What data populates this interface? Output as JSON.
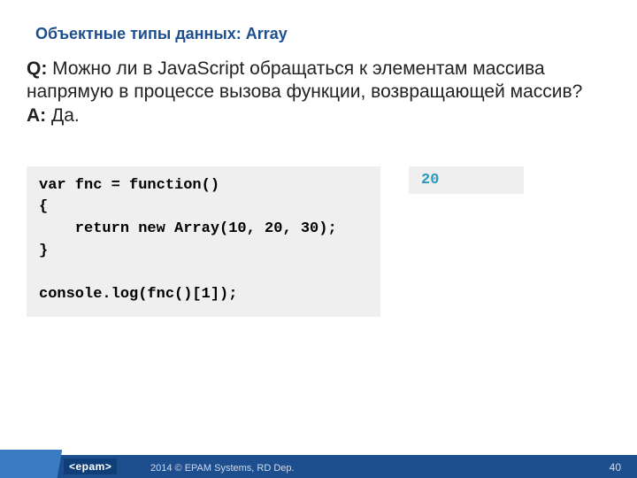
{
  "header": {
    "title": "Объектные типы данных: Array"
  },
  "qa": {
    "q_label": "Q:",
    "q_text": " Можно ли в JavaScript обращаться к элементам массива напрямую в процессе вызова функции, возвращающей массив?",
    "a_label": "A:",
    "a_text": " Да."
  },
  "code": "var fnc = function()\n{\n    return new Array(10, 20, 30);\n}\n\nconsole.log(fnc()[1]);",
  "output": "20",
  "footer": {
    "logo": "<epam>",
    "copyright": "2014 © EPAM Systems, RD Dep.",
    "page": "40"
  }
}
